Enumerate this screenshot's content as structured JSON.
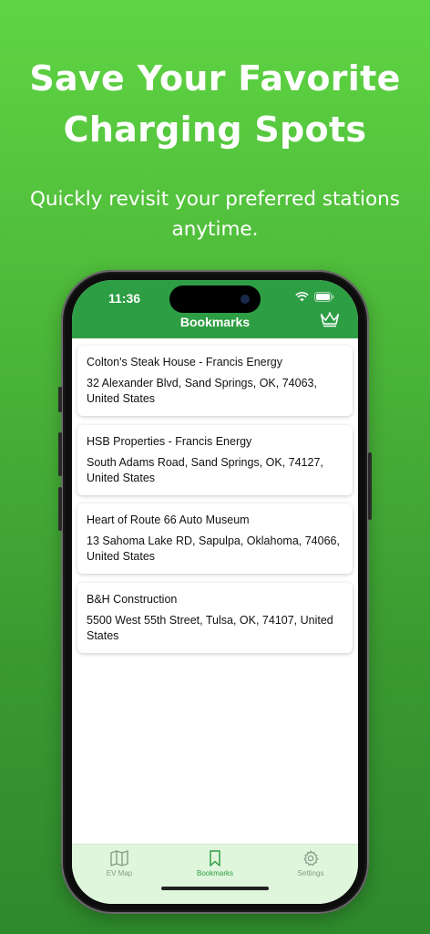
{
  "promo": {
    "headline": "Save Your Favorite Charging Spots",
    "subline": "Quickly revisit your preferred stations anytime."
  },
  "status_bar": {
    "time": "11:36"
  },
  "navbar": {
    "title": "Bookmarks",
    "crown_icon": "crown-icon"
  },
  "bookmarks": [
    {
      "name": "Colton's Steak House - Francis Energy",
      "address": "32 Alexander Blvd, Sand Springs, OK, 74063, United States"
    },
    {
      "name": "HSB Properties - Francis Energy",
      "address": "South Adams Road, Sand Springs, OK, 74127, United States"
    },
    {
      "name": "Heart of Route 66 Auto Museum",
      "address": "13 Sahoma Lake RD, Sapulpa, Oklahoma, 74066, United States"
    },
    {
      "name": "B&H Construction",
      "address": "5500 West 55th Street, Tulsa, OK, 74107, United States"
    }
  ],
  "tabbar": {
    "tabs": [
      {
        "label": "EV Map",
        "icon": "map-icon",
        "active": false
      },
      {
        "label": "Bookmarks",
        "icon": "bookmark-icon",
        "active": true
      },
      {
        "label": "Settings",
        "icon": "gear-icon",
        "active": false
      }
    ]
  },
  "colors": {
    "brand_green": "#2e9e44",
    "tabbar_bg": "#dff5dc"
  }
}
